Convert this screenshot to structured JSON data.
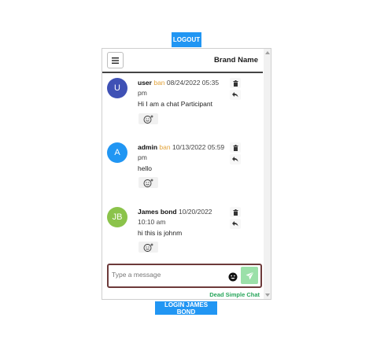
{
  "top_button": {
    "label": "LOGOUT"
  },
  "bottom_button": {
    "label": "LOGIN JAMES BOND"
  },
  "header": {
    "brand": "Brand Name"
  },
  "colors": {
    "accent": "#2196f3",
    "ban": "#e2a33a",
    "send": "#9be0a9",
    "powered": "#27a55a",
    "composer_border": "#6d3a3a"
  },
  "messages": [
    {
      "initial": "U",
      "avatar_color": "#3f51b5",
      "sender": "user",
      "ban": "ban",
      "time": "08/24/2022 05:35 pm",
      "text": "Hi I am a chat Participant"
    },
    {
      "initial": "A",
      "avatar_color": "#2196f3",
      "sender": "admin",
      "ban": "ban",
      "time": "10/13/2022 05:59 pm",
      "text": "hello"
    },
    {
      "initial": "JB",
      "avatar_color": "#8bc34a",
      "sender": "James bond",
      "ban": "",
      "time": "10/20/2022 10:10 am",
      "text": "hi this is johnm"
    }
  ],
  "composer": {
    "placeholder": "Type a message"
  },
  "footer": {
    "powered_by": "Dead Simple Chat"
  }
}
